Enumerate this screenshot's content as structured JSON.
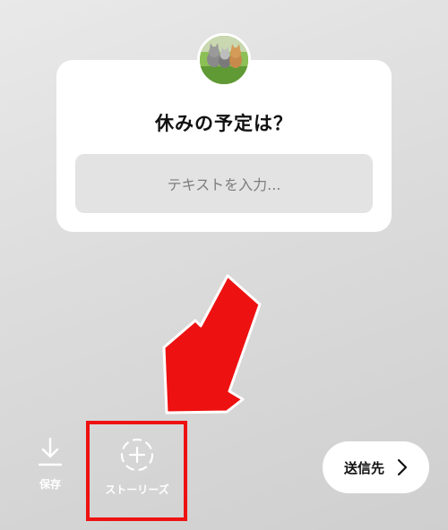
{
  "question_card": {
    "question": "休みの予定は？",
    "answer_placeholder": "テキストを入力..."
  },
  "bottom_bar": {
    "save_label": "保存",
    "stories_label": "ストーリーズ",
    "send_label": "送信先"
  },
  "icons": {
    "avatar": "profile-photo-kittens",
    "save": "download-icon",
    "stories": "dashed-circle-plus-icon",
    "send": "chevron-right-icon",
    "annotation": "red-arrow"
  },
  "colors": {
    "annotation": "#ee1111",
    "card": "#ffffff",
    "input_background": "#e3e3e3",
    "placeholder_text": "#7d7d7d",
    "bar_text": "#ffffff"
  }
}
